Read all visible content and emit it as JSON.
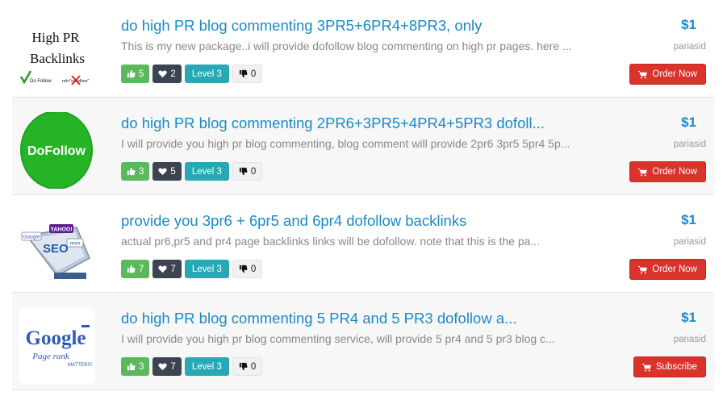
{
  "listings": [
    {
      "title": "do high PR blog commenting 3PR5+6PR4+8PR3, only",
      "description": "This is my new package..i will provide dofollow blog commenting on high pr pages. here ...",
      "likes": "5",
      "hearts": "2",
      "level": "Level 3",
      "dislikes": "0",
      "price": "$1",
      "seller": "pariasid",
      "button_label": "Order Now",
      "thumb_text": [
        "High PR",
        "Backlinks",
        "Do Follow",
        "rel=\"nofollow\""
      ]
    },
    {
      "title": "do high PR blog commenting 2PR6+3PR5+4PR4+5PR3 dofoll...",
      "description": "I will provide you high pr blog commenting, blog comment will provide 2pr6 3pr5 5pr4 5p...",
      "likes": "3",
      "hearts": "5",
      "level": "Level 3",
      "dislikes": "0",
      "price": "$1",
      "seller": "pariasid",
      "button_label": "Order Now",
      "thumb_text": [
        "DoFollow"
      ]
    },
    {
      "title": "provide you 3pr6 + 6pr5 and 6pr4 dofollow backlinks",
      "description": "actual pr6,pr5 and pr4 page backlinks links will be dofollow. note that this is the pa...",
      "likes": "7",
      "hearts": "7",
      "level": "Level 3",
      "dislikes": "0",
      "price": "$1",
      "seller": "pariasid",
      "button_label": "Order Now",
      "thumb_text": [
        "SEO",
        "YAHOO!",
        "Google",
        "msn"
      ]
    },
    {
      "title": "do high PR blog commenting 5 PR4 and 5 PR3 dofollow a...",
      "description": "I will provide you high pr blog commenting service, will provide 5 pr4 and 5 pr3 blog c...",
      "likes": "3",
      "hearts": "7",
      "level": "Level 3",
      "dislikes": "0",
      "price": "$1",
      "seller": "pariasid",
      "button_label": "Subscribe",
      "thumb_text": [
        "Google",
        "Page rank",
        "MATTERS!"
      ]
    }
  ],
  "colors": {
    "title": "#1a8ac6",
    "likes": "#5cb85c",
    "hearts": "#3b4450",
    "level": "#26a9b5",
    "order": "#d9332b"
  }
}
